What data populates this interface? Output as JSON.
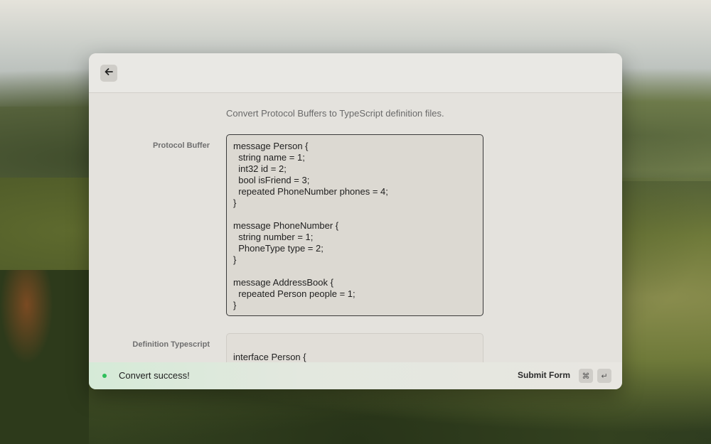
{
  "window": {
    "description": "Convert Protocol Buffers to TypeScript definition files."
  },
  "form": {
    "protocol_buffer_label": "Protocol Buffer",
    "protocol_buffer_value": "message Person {\n  string name = 1;\n  int32 id = 2;\n  bool isFriend = 3;\n  repeated PhoneNumber phones = 4;\n}\n\nmessage PhoneNumber {\n  string number = 1;\n  PhoneType type = 2;\n}\n\nmessage AddressBook {\n  repeated Person people = 1;\n}",
    "definition_label": "Definition Typescript",
    "definition_value": "interface Person {\n  name: string;\n  id: number;"
  },
  "footer": {
    "status_text": "Convert success!",
    "status_color": "#2fbf5a",
    "submit_label": "Submit Form",
    "shortcut_cmd": "⌘",
    "shortcut_enter": "↵"
  },
  "icons": {
    "back": "arrow-left-icon"
  }
}
